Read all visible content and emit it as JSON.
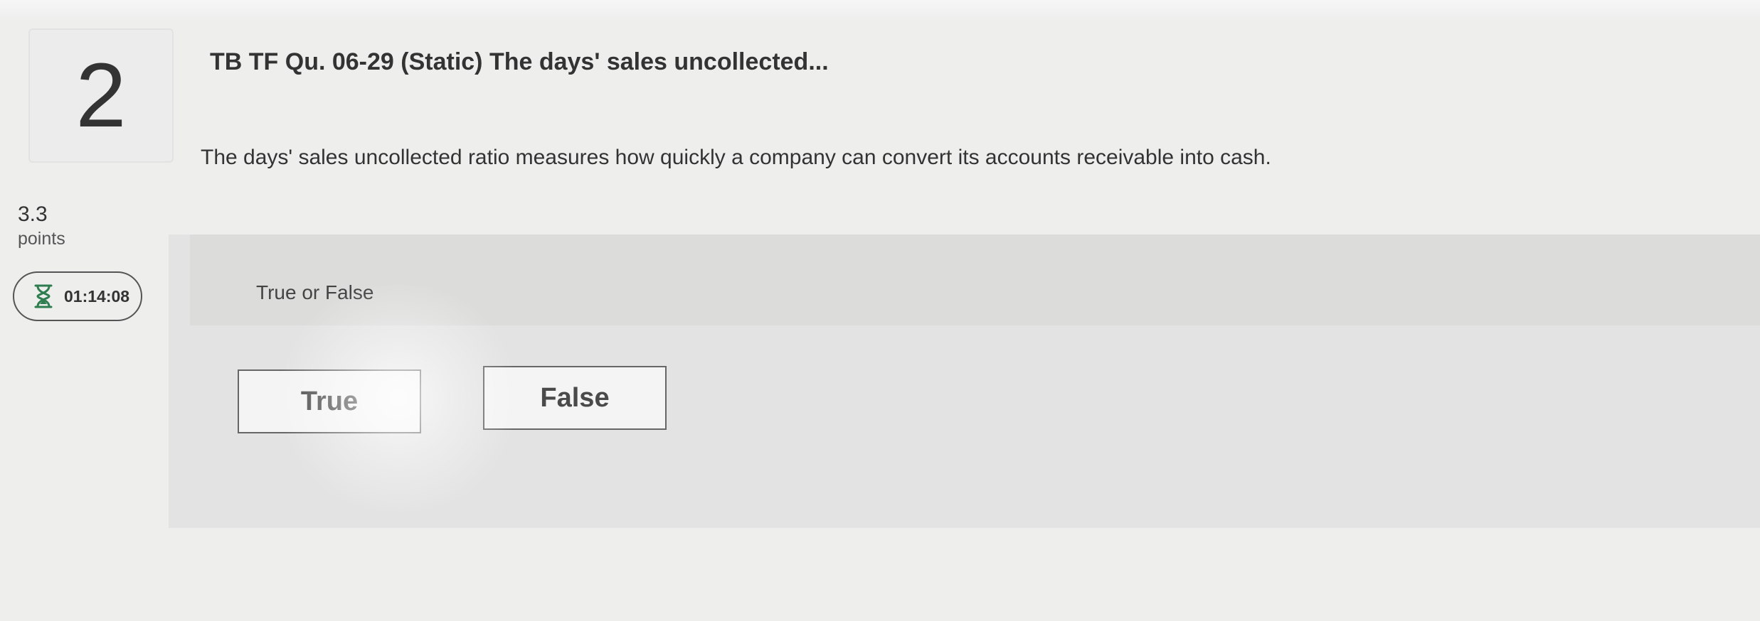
{
  "question": {
    "number": "2",
    "title": "TB TF Qu. 06-29 (Static) The days' sales uncollected...",
    "text": "The days' sales uncollected ratio measures how quickly a company can convert its accounts receivable into cash.",
    "points_value": "3.3",
    "points_label": "points"
  },
  "timer": {
    "icon": "hourglass-icon",
    "value": "01:14:08",
    "accent_color": "#2e7d4f"
  },
  "answer": {
    "type_label": "True or False",
    "choices": [
      {
        "label": "True"
      },
      {
        "label": "False"
      }
    ]
  }
}
